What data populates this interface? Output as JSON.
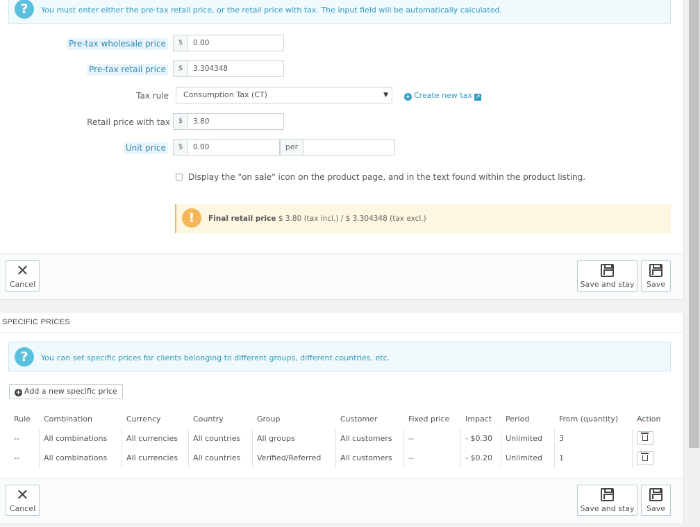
{
  "price_info": "You must enter either the pre-tax retail price, or the retail price with tax. The input field will be automatically calculated.",
  "fields": {
    "wholesale": {
      "label": "Pre-tax wholesale price",
      "currency": "$",
      "value": "0.00"
    },
    "retail": {
      "label": "Pre-tax retail price",
      "currency": "$",
      "value": "3.304348"
    },
    "tax_rule": {
      "label": "Tax rule",
      "value": "Consumption Tax (CT)",
      "create_link": "Create new tax"
    },
    "retail_with_tax": {
      "label": "Retail price with tax",
      "currency": "$",
      "value": "3.80"
    },
    "unit_price": {
      "label": "Unit price",
      "currency": "$",
      "value": "0.00",
      "per_label": "per",
      "per_value": ""
    }
  },
  "on_sale_label": "Display the \"on sale\" icon on the product page, and in the text found within the product listing.",
  "final_price": {
    "label": "Final retail price",
    "text": "$ 3.80 (tax incl.) / $ 3.304348 (tax excl.)"
  },
  "buttons": {
    "cancel": "Cancel",
    "save_and_stay": "Save and stay",
    "save": "Save"
  },
  "specific": {
    "title": "SPECIFIC PRICES",
    "info": "You can set specific prices for clients belonging to different groups, different countries, etc.",
    "add_button": "Add a new specific price",
    "headers": [
      "Rule",
      "Combination",
      "Currency",
      "Country",
      "Group",
      "Customer",
      "Fixed price",
      "Impact",
      "Period",
      "From (quantity)",
      "Action"
    ],
    "rows": [
      [
        "--",
        "All combinations",
        "All currencies",
        "All countries",
        "All groups",
        "All customers",
        "--",
        "- $0.30",
        "Unlimited",
        "3"
      ],
      [
        "--",
        "All combinations",
        "All currencies",
        "All countries",
        "Verified/Referred",
        "All customers",
        "--",
        "- $0.20",
        "Unlimited",
        "1"
      ]
    ]
  },
  "colors": {
    "accent": "#2f9bc0",
    "info_bg": "#f0f9fb",
    "warn_bg": "#fdf6e0",
    "warn_icon": "#f5b65a"
  }
}
